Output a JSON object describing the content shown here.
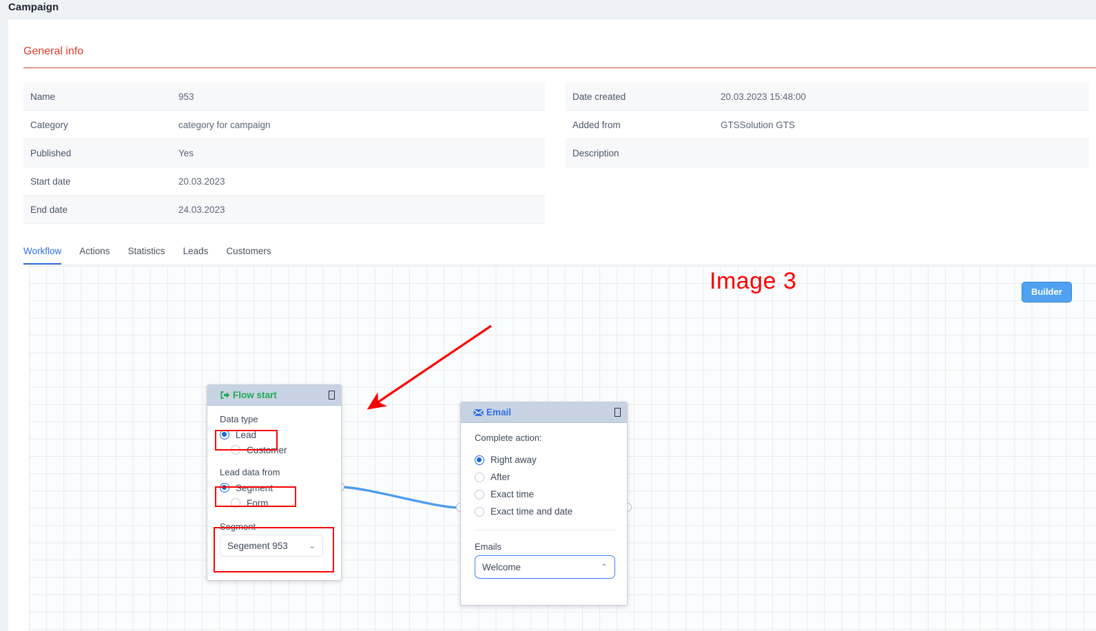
{
  "page": {
    "title": "Campaign"
  },
  "general_info": {
    "heading": "General info",
    "left_rows": [
      {
        "label": "Name",
        "value": "953"
      },
      {
        "label": "Category",
        "value": "category for campaign"
      },
      {
        "label": "Published",
        "value": "Yes"
      },
      {
        "label": "Start date",
        "value": "20.03.2023"
      },
      {
        "label": "End date",
        "value": "24.03.2023"
      }
    ],
    "right_rows": [
      {
        "label": "Date created",
        "value": "20.03.2023 15:48:00"
      },
      {
        "label": "Added from",
        "value": "GTSSolution GTS"
      },
      {
        "label": "Description",
        "value": ""
      }
    ]
  },
  "tabs": [
    {
      "label": "Workflow",
      "active": true
    },
    {
      "label": "Actions",
      "active": false
    },
    {
      "label": "Statistics",
      "active": false
    },
    {
      "label": "Leads",
      "active": false
    },
    {
      "label": "Customers",
      "active": false
    }
  ],
  "canvas": {
    "annotation_text": "Image 3",
    "annotation_color": "#fb0000",
    "builder_button": "Builder",
    "connector_color": "#4a9bf0"
  },
  "flow_start_node": {
    "title": "Flow start",
    "title_color": "#1faa55",
    "icon": "sign-in-icon",
    "corner_icon": "duplicate-icon",
    "data_type_label": "Data type",
    "data_type_options": [
      {
        "label": "Lead",
        "selected": true
      },
      {
        "label": "Customer",
        "selected": false
      }
    ],
    "lead_data_from_label": "Lead data from",
    "lead_data_from_options": [
      {
        "label": "Segment",
        "selected": true
      },
      {
        "label": "Form",
        "selected": false
      }
    ],
    "segment_label": "Segment",
    "segment_value": "Segement 953"
  },
  "email_node": {
    "title": "Email",
    "title_color": "#2f6fe4",
    "icon": "envelope-icon",
    "corner_icon": "duplicate-icon",
    "complete_action_label": "Complete action:",
    "complete_action_options": [
      {
        "label": "Right away",
        "selected": true
      },
      {
        "label": "After",
        "selected": false
      },
      {
        "label": "Exact time",
        "selected": false
      },
      {
        "label": "Exact time and date",
        "selected": false
      }
    ],
    "emails_label": "Emails",
    "emails_value": "Welcome"
  }
}
